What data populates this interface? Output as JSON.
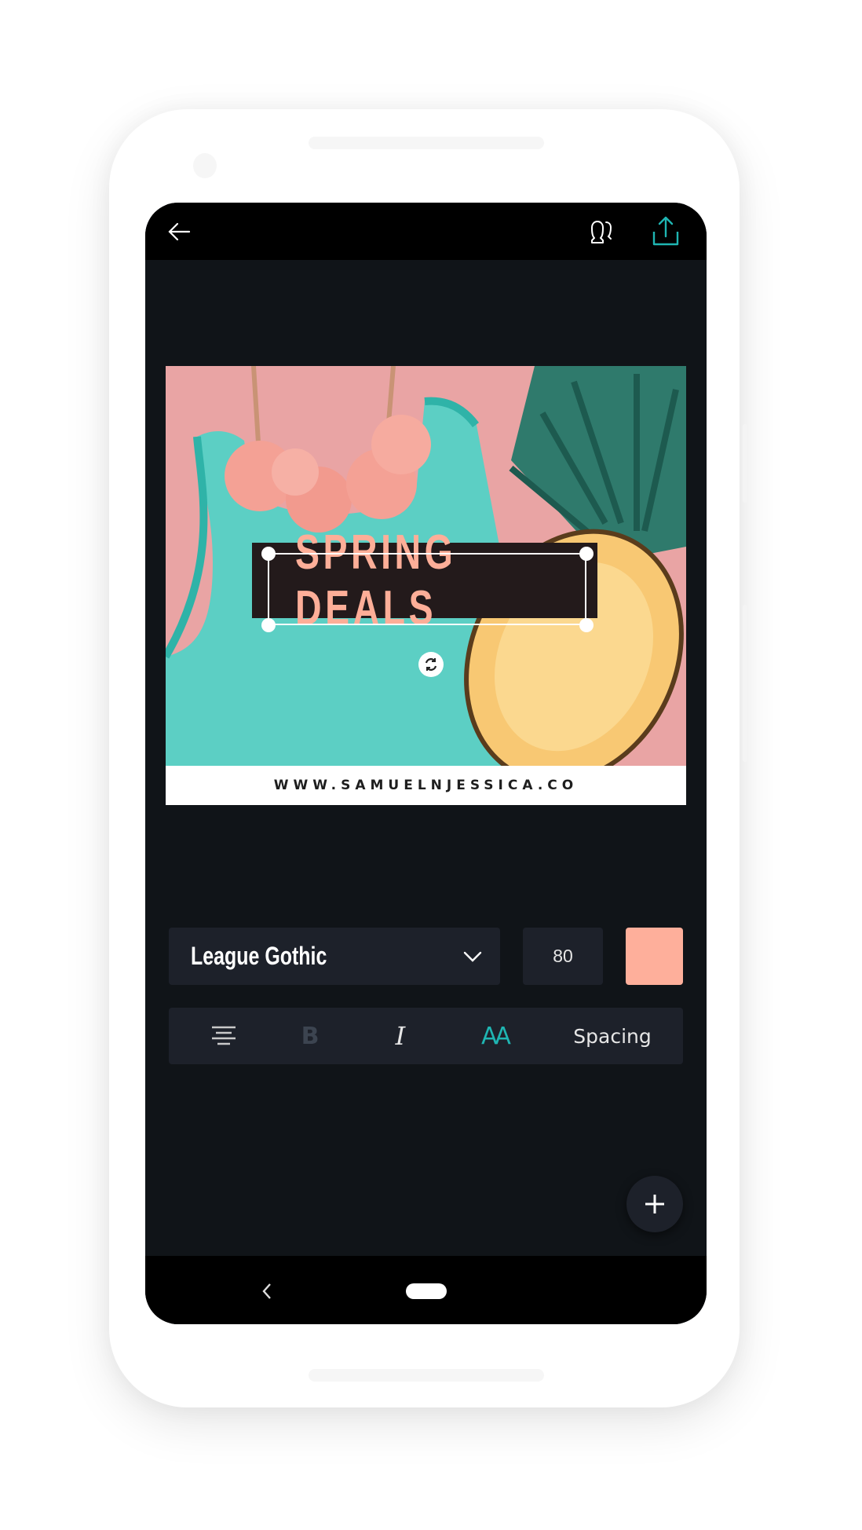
{
  "app": {
    "top_bar": {
      "back_icon": "arrow-left-icon",
      "collaborators_icon": "people-icon",
      "share_icon": "upload-share-icon"
    },
    "colors": {
      "accent": "#1fb5b2",
      "screen_bg": "#101418",
      "panel_bg": "#1d212a",
      "text_color": "#feaf9b"
    },
    "design": {
      "headline": "SPRING DEALS",
      "url": "WWW.SAMUELNJESSICA.CO",
      "rotate_icon": "rotate-icon"
    },
    "text_controls": {
      "font_family": "League Gothic",
      "font_size": "80",
      "text_color": "#feaf9b",
      "align_icon": "align-center-icon",
      "bold_label": "B",
      "italic_label": "I",
      "case_label": "AA",
      "spacing_label": "Spacing"
    },
    "fab": {
      "icon": "plus-icon"
    },
    "nav": {
      "back_icon": "chevron-left-icon",
      "home_icon": "home-pill-icon"
    }
  }
}
